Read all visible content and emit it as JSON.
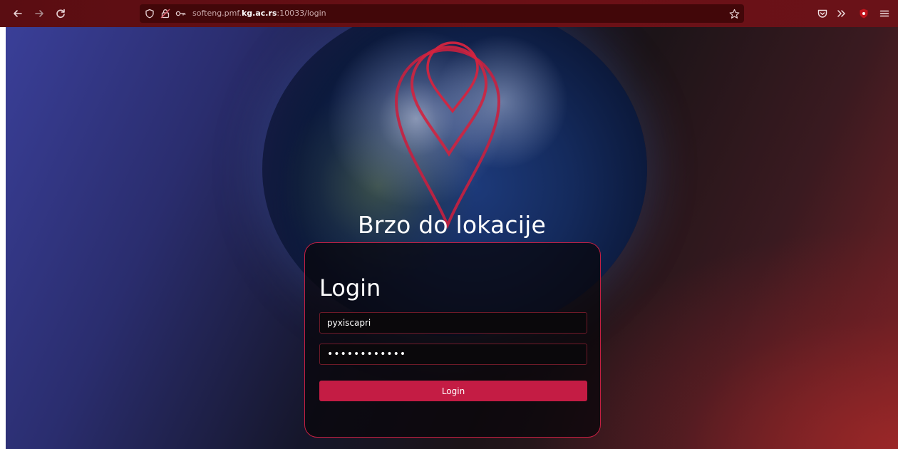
{
  "browser": {
    "url_prefix": "softeng.pmf.",
    "url_domain": "kg.ac.rs",
    "url_suffix": ":10033/login",
    "icons": [
      "back-arrow-icon",
      "forward-arrow-icon",
      "reload-icon",
      "shield-icon",
      "lock-icon",
      "key-icon",
      "bookmark-star-icon",
      "pocket-icon",
      "extensions-icon",
      "ublock-icon",
      "menu-icon"
    ]
  },
  "page": {
    "brand_title": "Brzo do lokacije",
    "logo_icon": "map-pin-icon"
  },
  "login": {
    "title": "Login",
    "username_value": "pyxiscapri",
    "password_value": "••••••••••••",
    "submit_label": "Login"
  },
  "colors": {
    "accent": "#c41c44",
    "chrome": "#5a0d12",
    "urlbar": "#420709"
  }
}
